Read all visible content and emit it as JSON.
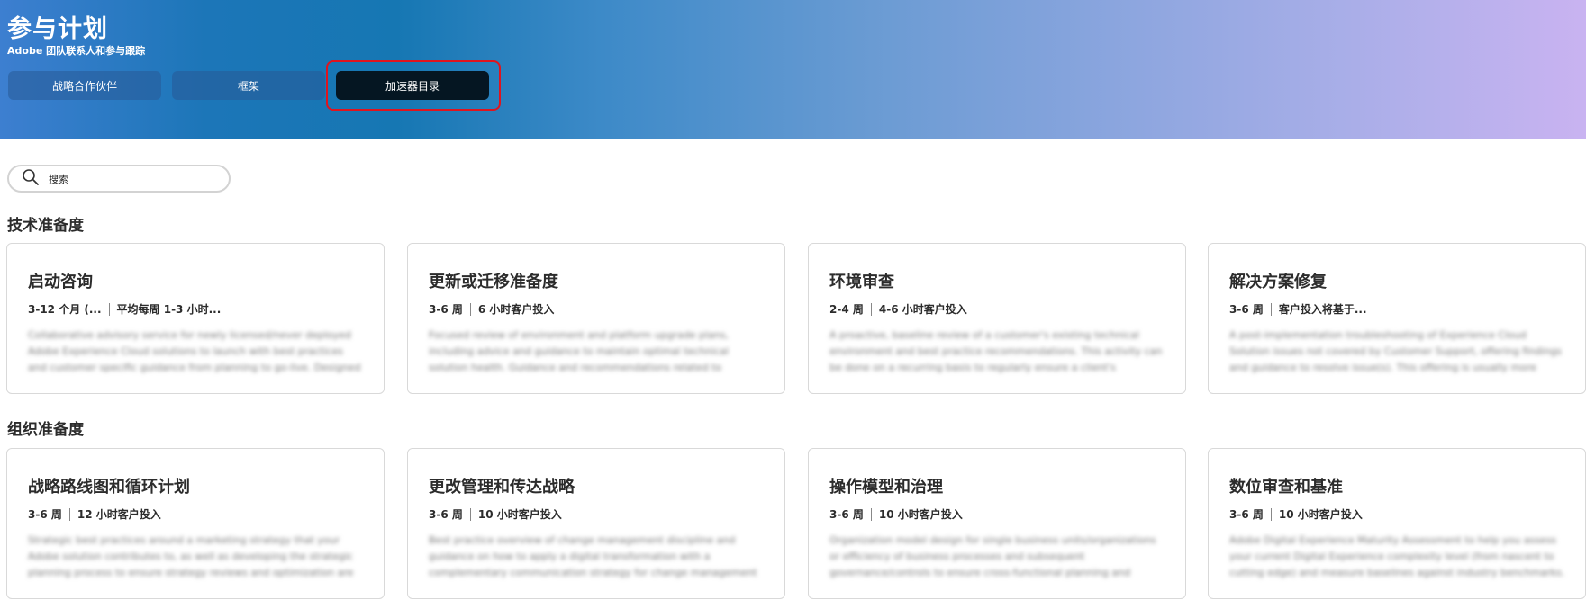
{
  "header": {
    "title": "参与计划",
    "subtitle": "Adobe 团队联系人和参与跟踪",
    "tabs": [
      {
        "label": "战略合作伙伴"
      },
      {
        "label": "框架"
      },
      {
        "label": "加速器目录",
        "selected": true
      }
    ]
  },
  "search": {
    "placeholder": "搜索",
    "icon": "search-icon"
  },
  "sections": [
    {
      "title": "技术准备度",
      "cards": [
        {
          "title": "启动咨询",
          "duration": "3-12 个月 (...",
          "effort": "平均每周 1-3 小时...",
          "description": "Collaborative advisory service for newly licensed/never deployed Adobe Experience Cloud solutions to launch with best practices and customer specific guidance from planning to go-live. Designed to start at the earliest..."
        },
        {
          "title": "更新或迁移准备度",
          "duration": "3-6 周",
          "effort": "6 小时客户投入",
          "description": "Focused review of environment and platform upgrade plans, including advice and guidance to maintain optimal technical solution health. Guidance and recommendations related to migration feasibility, architecture and..."
        },
        {
          "title": "环境审查",
          "duration": "2-4 周",
          "effort": "4-6 小时客户投入",
          "description": "A proactive, baseline review of a customer's existing technical environment and best practice recommendations. This activity can be done on a recurring basis to regularly ensure a client's application is performing at optimal leve..."
        },
        {
          "title": "解决方案修复",
          "duration": "3-6 周",
          "effort": "客户投入将基于...",
          "description": "A post-implementation troubleshooting of Experience Cloud Solution issues not covered by Customer Support, offering findings and guidance to resolve issue(s). This offering is usually more reactive in nature."
        }
      ]
    },
    {
      "title": "组织准备度",
      "cards": [
        {
          "title": "战略路线图和循环计划",
          "duration": "3-6 周",
          "effort": "12 小时客户投入",
          "description": "Strategic best practices around a marketing strategy that your Adobe solution contributes to, as well as developing the strategic planning process to ensure strategy reviews and optimization are part of ongoing operations..."
        },
        {
          "title": "更改管理和传达战略",
          "duration": "3-6 周",
          "effort": "10 小时客户投入",
          "description": "Best practice overview of change management discipline and guidance on how to apply a digital transformation with a complementary communication strategy for change management support, as related to a single business u..."
        },
        {
          "title": "操作模型和治理",
          "duration": "3-6 周",
          "effort": "10 小时客户投入",
          "description": "Organization model design for single business units/organizations or efficiency of business processes and subsequent governance/controls to ensure cross-functional planning and strategy adherence (i.e., steering..."
        },
        {
          "title": "数位审查和基准",
          "duration": "3-6 周",
          "effort": "10 小时客户投入",
          "description": "Adobe Digital Experience Maturity Assessment to help you assess your current Digital Experience complexity level (from nascent to cutting edge) and measure baselines against industry benchmarks. Our approach includ..."
        }
      ]
    }
  ]
}
